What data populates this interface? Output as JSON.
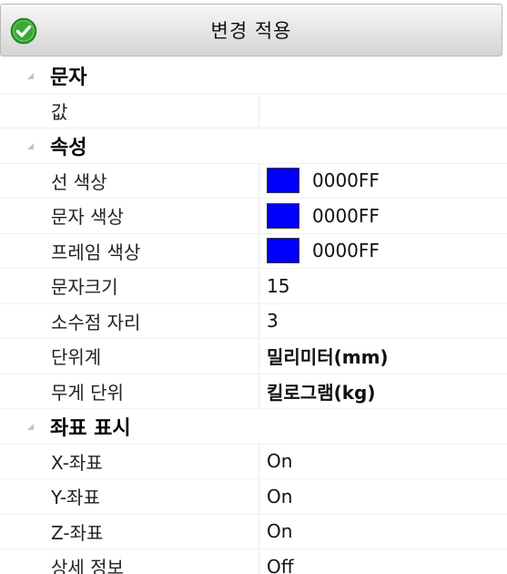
{
  "apply": {
    "label": "변경 적용",
    "icon": "check-circle-icon",
    "icon_color": "#3aa935"
  },
  "categories": [
    {
      "label": "문자",
      "properties": [
        {
          "name": "값",
          "value": ""
        }
      ]
    },
    {
      "label": "속성",
      "properties": [
        {
          "name": "선 색상",
          "value": "0000FF",
          "swatch": "#0000FF"
        },
        {
          "name": "문자 색상",
          "value": "0000FF",
          "swatch": "#0000FF"
        },
        {
          "name": "프레임 색상",
          "value": "0000FF",
          "swatch": "#0000FF"
        },
        {
          "name": "문자크기",
          "value": "15"
        },
        {
          "name": "소수점 자리",
          "value": "3"
        },
        {
          "name": "단위계",
          "value": "밀리미터(mm)",
          "bold": true
        },
        {
          "name": "무게 단위",
          "value": "킬로그램(kg)",
          "bold": true
        }
      ]
    },
    {
      "label": "좌표 표시",
      "properties": [
        {
          "name": "X-좌표",
          "value": "On"
        },
        {
          "name": "Y-좌표",
          "value": "On"
        },
        {
          "name": "Z-좌표",
          "value": "On"
        },
        {
          "name": "상세 정보",
          "value": "Off"
        }
      ]
    }
  ]
}
